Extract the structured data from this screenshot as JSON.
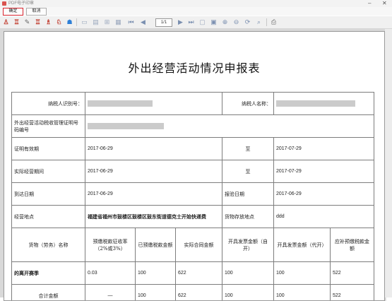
{
  "window": {
    "title": "PDF电子印章"
  },
  "actions": {
    "confirm": "确定",
    "cancel": "取消"
  },
  "toolbar": {
    "page_field": "1/1",
    "icons": [
      "stamp-icon",
      "seam-stamp-icon",
      "pen-icon",
      "seal-icon",
      "batch-seal-icon",
      "multi-seal-icon",
      "cloud-seal-icon",
      "fit-page-icon",
      "fit-width-icon",
      "actual-size-icon",
      "first-page-icon",
      "prev-page-icon",
      "next-page-icon",
      "last-page-icon",
      "page-view-icon",
      "zoom-in-icon",
      "zoom-out-icon",
      "rotate-icon",
      "find-icon",
      "print-icon"
    ]
  },
  "document": {
    "title": "外出经营活动情况申报表",
    "rows": {
      "taxpayer_id_label": "纳税人识别号：",
      "taxpayer_name_label": "纳税人名称：",
      "cert_no_label": "外出经营活动税收管理证明号码编号",
      "valid_label": "证明有效期",
      "valid_from": "2017-06-29",
      "valid_to_label": "至",
      "valid_to": "2017-07-29",
      "period_label": "实际经营期间",
      "period_from": "2017-06-29",
      "period_to_label": "至",
      "period_to": "2017-07-29",
      "arrival_label": "到达日期",
      "arrival_date": "2017-06-29",
      "inspection_label": "报验日期",
      "inspection_date": "2017-06-29",
      "location_label": "经营地点",
      "location_value": "福建省福州市鼓楼区鼓楼区鼓东街道德克士开始快递费",
      "storage_label": "货物存放地点",
      "storage_value": "ddd"
    },
    "goods_headers": [
      "货物（劳务）名称",
      "预缴税款征收率（2%或3%）",
      "已预缴税款金额",
      "实际合同金额",
      "开具发票金额（自开）",
      "开具发票金额（代开）",
      "应补预缴税款金额"
    ],
    "goods_rows": [
      [
        "的离开赛季",
        "0.03",
        "100",
        "622",
        "100",
        "100",
        "522"
      ]
    ],
    "total_row": [
      "合计金额",
      "—",
      "100",
      "622",
      "100",
      "100",
      "522"
    ]
  }
}
